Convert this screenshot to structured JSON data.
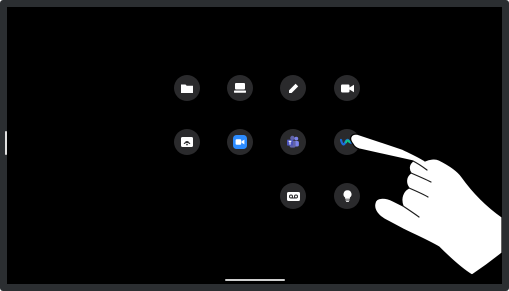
{
  "colors": {
    "screen_bg": "#000000",
    "button_bg": "#2a2a2c",
    "icon_fg": "#ffffff",
    "zoom_blue": "#2d8cff",
    "teams_purple": "#6264a7",
    "webex_blue": "#1d6bd8",
    "webex_green": "#0fc38f"
  },
  "home_screen": {
    "rows": [
      [
        "files-icon",
        "whiteboard-icon",
        "annotate-pencil-icon",
        "call-camera-icon"
      ],
      [
        "share-screen-icon",
        "zoom-icon",
        "teams-icon",
        "webex-icon"
      ],
      [
        "voicemail-icon",
        "lightbulb-icon"
      ]
    ]
  },
  "gesture": "hand-tapping-webex-icon"
}
